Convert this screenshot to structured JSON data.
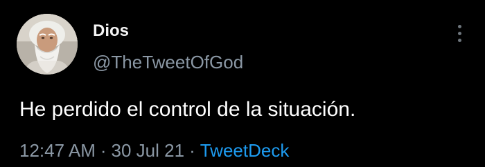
{
  "tweet": {
    "author": {
      "display_name": "Dios",
      "handle": "@TheTweetOfGod",
      "avatar_icon": "bearded-man-avatar"
    },
    "text": "He perdido el control de la situación.",
    "meta": {
      "time": "12:47 AM",
      "separator": "·",
      "date": "30 Jul 21",
      "source": "TweetDeck"
    },
    "more_icon": "vertical-ellipsis-icon"
  },
  "colors": {
    "background": "#000000",
    "primary_text": "#ffffff",
    "secondary_text": "#8b98a5",
    "link": "#1d9bf0"
  }
}
